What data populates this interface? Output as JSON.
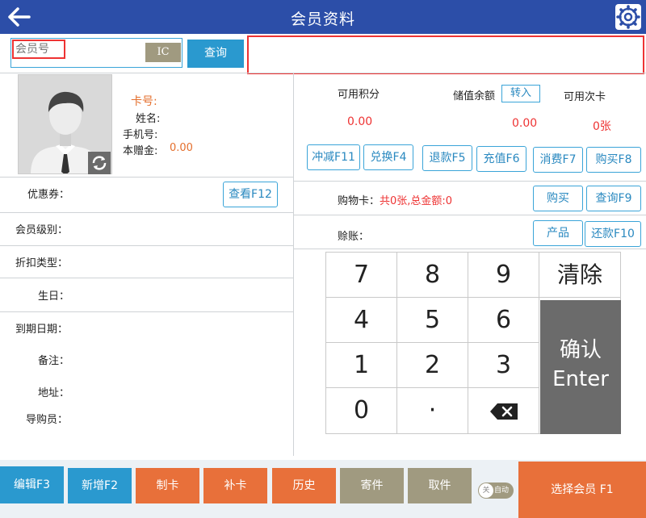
{
  "header": {
    "title": "会员资料"
  },
  "search": {
    "placeholder": "会员号",
    "ic_label": "IC",
    "query_label": "查询"
  },
  "member": {
    "card_no_label": "卡号:",
    "name_label": "姓名:",
    "phone_label": "手机号:",
    "gift_label": "本赠金:",
    "gift_value": "0.00"
  },
  "balances": {
    "points_label": "可用积分",
    "points_value": "0.00",
    "stored_label": "储值余额",
    "stored_value": "0.00",
    "transfer_label": "转入",
    "times_label": "可用次卡",
    "times_value": "0张"
  },
  "actions": {
    "deduct": "冲减F11",
    "exchange": "兑换F4",
    "refund": "退款F5",
    "recharge": "充值F6",
    "consume": "消费F7",
    "buy_f8": "购买F8",
    "view_f12": "查看F12",
    "buy": "购买",
    "query_f9": "查询F9",
    "product": "产品",
    "repay": "还款F10"
  },
  "fields": {
    "coupon": "优惠券：",
    "level": "会员级别：",
    "discount": "折扣类型：",
    "birthday": "生日：",
    "expiry": "到期日期：",
    "remark": "备注：",
    "address": "地址：",
    "guide": "导购员：",
    "shopping_card": "购物卡：",
    "shopping_card_value": "共0张,总金额:0",
    "credit": "赊账："
  },
  "keypad": {
    "k7": "7",
    "k8": "8",
    "k9": "9",
    "clear": "清除",
    "k4": "4",
    "k5": "5",
    "k6": "6",
    "k1": "1",
    "k2": "2",
    "k3": "3",
    "k0": "0",
    "dot": "·",
    "confirm": "确认",
    "enter": "Enter"
  },
  "bottom": {
    "edit": "编辑F3",
    "add": "新增F2",
    "make_card": "制卡",
    "reissue": "补卡",
    "history": "历史",
    "deposit": "寄件",
    "pickup": "取件",
    "toggle_off": "关",
    "toggle_auto": "自动",
    "select_member": "选择会员 F1"
  },
  "colors": {
    "header": "#2c4ea8",
    "accent_blue": "#2a99cf",
    "accent_orange": "#e8703a",
    "muted": "#a09a80",
    "alert": "#e33333"
  }
}
